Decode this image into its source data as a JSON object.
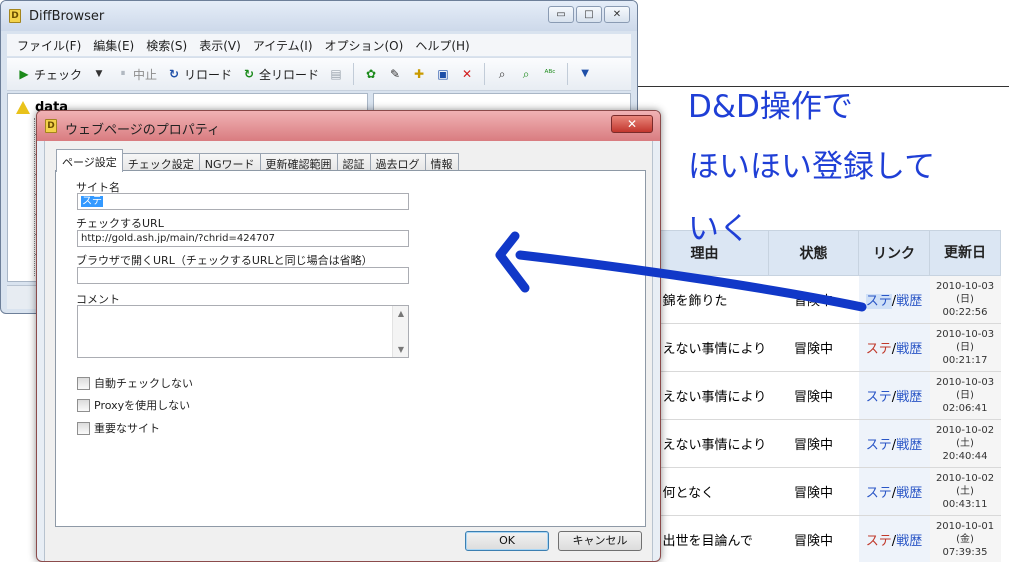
{
  "colors": {
    "accent_blue": "#1f3fd6",
    "stroke_arrow": "#1138c8",
    "dialog_title": "#d97c80"
  },
  "annotation": {
    "line1": "D&D操作で",
    "line2": "ほいほい登録して",
    "line3": "いく"
  },
  "webtable": {
    "headers": {
      "reason": "理由",
      "state": "状態",
      "link": "リンク",
      "date": "更新日"
    },
    "rows": [
      {
        "reason": "錦を飾りた",
        "state": "冒険中",
        "link1": "ステ",
        "sep": "/",
        "link2": "戦歴",
        "date1": "2010-10-03",
        "date2": "(日)",
        "date3": "00:22:56"
      },
      {
        "reason": "えない事情により",
        "state": "冒険中",
        "link1": "ステ",
        "sep": "/",
        "link2": "戦歴",
        "date1": "2010-10-03",
        "date2": "(日)",
        "date3": "00:21:17"
      },
      {
        "reason": "えない事情により",
        "state": "冒険中",
        "link1": "ステ",
        "sep": "/",
        "link2": "戦歴",
        "date1": "2010-10-03",
        "date2": "(日)",
        "date3": "02:06:41"
      },
      {
        "reason": "えない事情により",
        "state": "冒険中",
        "link1": "ステ",
        "sep": "/",
        "link2": "戦歴",
        "date1": "2010-10-02",
        "date2": "(土)",
        "date3": "20:40:44"
      },
      {
        "reason": "何となく",
        "state": "冒険中",
        "link1": "ステ",
        "sep": "/",
        "link2": "戦歴",
        "date1": "2010-10-02",
        "date2": "(土)",
        "date3": "00:43:11"
      },
      {
        "reason": "出世を目論んで",
        "state": "冒険中",
        "link1": "ステ",
        "sep": "/",
        "link2": "戦歴",
        "date1": "2010-10-01",
        "date2": "(金)",
        "date3": "07:39:35"
      }
    ]
  },
  "mainwin": {
    "title": "DiffBrowser",
    "caption": {
      "min": "▭",
      "max": "□",
      "close": "✕"
    },
    "menu": [
      "ファイル(F)",
      "編集(E)",
      "検索(S)",
      "表示(V)",
      "アイテム(I)",
      "オプション(O)",
      "ヘルプ(H)"
    ],
    "toolbar": {
      "check": "チェック",
      "stop": "中止",
      "reload": "リロード",
      "reload_all": "全リロード"
    },
    "icons": {
      "play": "▶",
      "dropdown": "▼",
      "pause": "⏸",
      "reload": "↻",
      "reload_all": "↻",
      "doc": "▤",
      "gear": "✿",
      "wrench": "✎",
      "new": "✚",
      "save": "▣",
      "delete": "✕",
      "zoom_in": "⌕",
      "zoom_out": "⌕",
      "spell": "ᴬᴮᶜ",
      "more": "▼"
    },
    "tree": {
      "root": "data"
    }
  },
  "dialog": {
    "title": "ウェブページのプロパティ",
    "close": "✕",
    "tabs": [
      "ページ設定",
      "チェック設定",
      "NGワード",
      "更新確認範囲",
      "認証",
      "過去ログ",
      "情報"
    ],
    "fields": {
      "site_name_label": "サイト名",
      "site_name_value": "ステ",
      "check_url_label": "チェックするURL",
      "check_url_value": "http://gold.ash.jp/main/?chrid=424707",
      "browser_url_label": "ブラウザで開くURL（チェックするURLと同じ場合は省略）",
      "browser_url_value": "",
      "comment_label": "コメント"
    },
    "checkboxes": [
      "自動チェックしない",
      "Proxyを使用しない",
      "重要なサイト"
    ],
    "buttons": {
      "ok": "OK",
      "cancel": "キャンセル"
    },
    "scroll": {
      "up": "▲",
      "down": "▼"
    }
  }
}
